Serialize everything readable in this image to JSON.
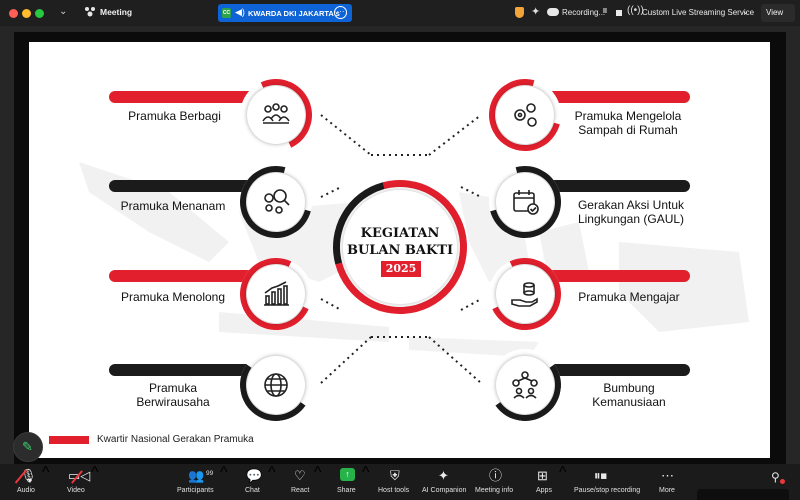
{
  "topbar": {
    "meeting_label": "Meeting",
    "share_name": "KWARDA DKI JAKARTA's",
    "recording_label": "Recording...",
    "pause_glyph": "II",
    "live_label": "Custom Live Streaming Service",
    "view_label": "View",
    "window_controls": [
      "close",
      "minimize",
      "zoom"
    ]
  },
  "slide": {
    "center_line1": "KEGIATAN",
    "center_line2": "BULAN BAKTI",
    "center_year": "2025",
    "footer": "Kwartir Nasional Gerakan Pramuka",
    "colors": {
      "red": "#e11f2d",
      "black": "#1b1b1b"
    },
    "activities": [
      {
        "side": "left",
        "bar": "red",
        "line1": "Pramuka Berbagi",
        "line2": "",
        "icon": "people-group-icon"
      },
      {
        "side": "left",
        "bar": "black",
        "line1": "Pramuka Menanam",
        "line2": "",
        "icon": "gears-search-icon"
      },
      {
        "side": "left",
        "bar": "red",
        "line1": "Pramuka Menolong",
        "line2": "",
        "icon": "growth-chart-icon"
      },
      {
        "side": "left",
        "bar": "black",
        "line1": "Pramuka",
        "line2": "Berwirausaha",
        "icon": "globe-icon"
      },
      {
        "side": "right",
        "bar": "red",
        "line1": "Pramuka Mengelola",
        "line2": "Sampah di Rumah",
        "icon": "gears-icon"
      },
      {
        "side": "right",
        "bar": "black",
        "line1": "Gerakan Aksi Untuk",
        "line2": "Lingkungan (GAUL)",
        "icon": "calendar-check-icon"
      },
      {
        "side": "right",
        "bar": "red",
        "line1": "Pramuka Mengajar",
        "line2": "",
        "icon": "hand-coins-icon"
      },
      {
        "side": "right",
        "bar": "black",
        "line1": "Bumbung",
        "line2": "Kemanusiaan",
        "icon": "network-people-icon"
      }
    ]
  },
  "toolbar": {
    "participants_count": "99",
    "items": [
      {
        "label": "Audio",
        "icon": "microphone-muted-icon"
      },
      {
        "label": "Video",
        "icon": "camera-off-icon"
      },
      {
        "label": "Participants",
        "icon": "participants-icon"
      },
      {
        "label": "Chat",
        "icon": "chat-icon"
      },
      {
        "label": "React",
        "icon": "heart-icon"
      },
      {
        "label": "Share",
        "icon": "share-icon"
      },
      {
        "label": "Host tools",
        "icon": "shield-icon"
      },
      {
        "label": "AI Companion",
        "icon": "ai-sparkle-icon"
      },
      {
        "label": "Meeting info",
        "icon": "info-icon"
      },
      {
        "label": "Apps",
        "icon": "apps-icon"
      },
      {
        "label": "Pause/stop recording",
        "icon": "pause-stop-icon"
      },
      {
        "label": "More",
        "icon": "more-icon"
      }
    ]
  }
}
